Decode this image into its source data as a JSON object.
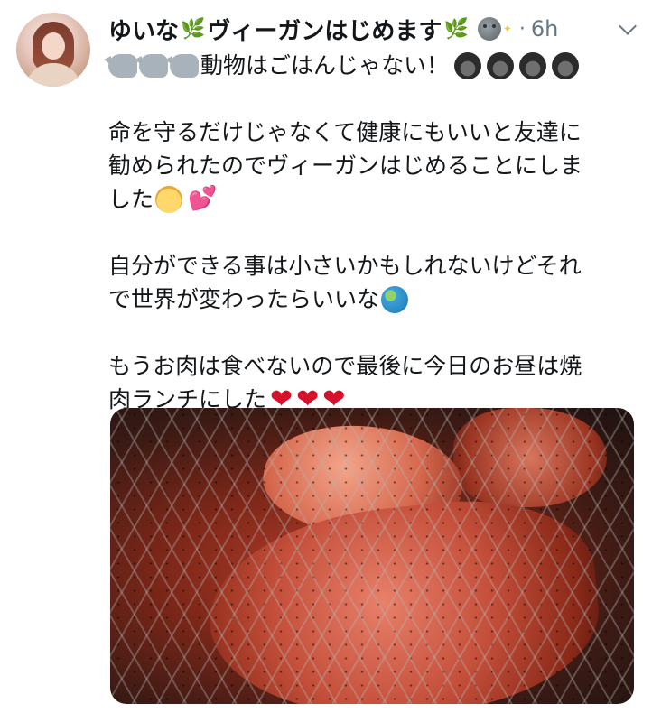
{
  "tweet": {
    "display_name_prefix": "ゆいな",
    "display_name_suffix": "ヴィーガンはじめます",
    "separator": "·",
    "timestamp": "6h",
    "lines": {
      "l1": "動物はごはんじゃない！",
      "l2": "命を守るだけじゃなくて健康にもいいと友達に",
      "l3": "勧められたのでヴィーガンはじめることにしま",
      "l4": "した",
      "l5": "自分ができる事は小さいかもしれないけどそれ",
      "l6": "で世界が変わったらいいな",
      "l7": "もうお肉は食べないので最後に今日のお昼は焼",
      "l8": "肉ランチにした"
    }
  },
  "icons": {
    "sprig": "herb-icon",
    "rhino": "rhino-icon",
    "gorilla": "gorilla-icon",
    "baby": "baby-icon",
    "two_hearts": "two-hearts-icon",
    "red_heart": "red-heart-icon",
    "earth": "earth-globe-icon",
    "moon": "moon-face-icon",
    "menu": "chevron-down-icon"
  },
  "colors": {
    "text": "#14171a",
    "muted": "#657786",
    "heart": "#d4122b"
  }
}
